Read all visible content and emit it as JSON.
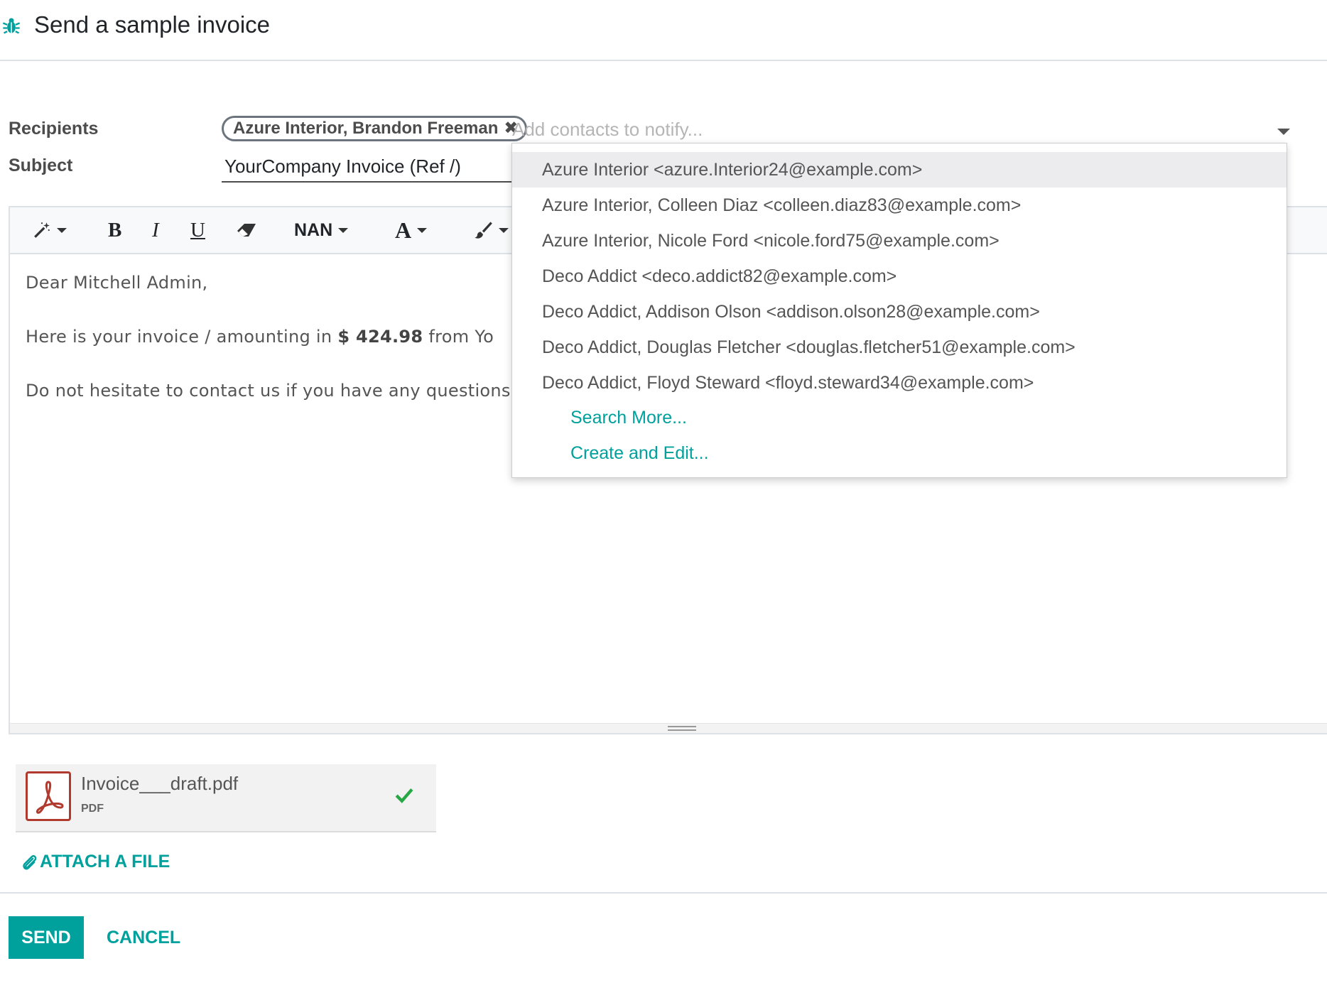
{
  "dialog": {
    "title": "Send a sample invoice"
  },
  "form": {
    "recipients_label": "Recipients",
    "subject_label": "Subject",
    "recipient_tag": "Azure Interior, Brandon Freeman",
    "recipient_placeholder": "Add contacts to notify...",
    "subject_value": "YourCompany Invoice (Ref /)"
  },
  "toolbar": {
    "bold": "B",
    "italic": "I",
    "underline": "U",
    "font_size": "NAN",
    "font_color": "A"
  },
  "body": {
    "greeting": "Dear Mitchell Admin,",
    "line2_prefix": "Here is your invoice / amounting in ",
    "amount": "$ 424.98",
    "line2_suffix": " from Yo",
    "line3": "Do not hesitate to contact us if you have any questions"
  },
  "dropdown": {
    "items": [
      "Azure Interior <azure.Interior24@example.com>",
      "Azure Interior, Colleen Diaz <colleen.diaz83@example.com>",
      "Azure Interior, Nicole Ford <nicole.ford75@example.com>",
      "Deco Addict <deco.addict82@example.com>",
      "Deco Addict, Addison Olson <addison.olson28@example.com>",
      "Deco Addict, Douglas Fletcher <douglas.fletcher51@example.com>",
      "Deco Addict, Floyd Steward <floyd.steward34@example.com>"
    ],
    "search_more": "Search More...",
    "create_edit": "Create and Edit..."
  },
  "attachment": {
    "name": "Invoice___draft.pdf",
    "ext": "PDF"
  },
  "actions": {
    "attach_file": "ATTACH A FILE",
    "send": "SEND",
    "cancel": "CANCEL"
  },
  "colors": {
    "accent": "#00a09d",
    "pdf": "#b03a2e",
    "check": "#28a745"
  }
}
